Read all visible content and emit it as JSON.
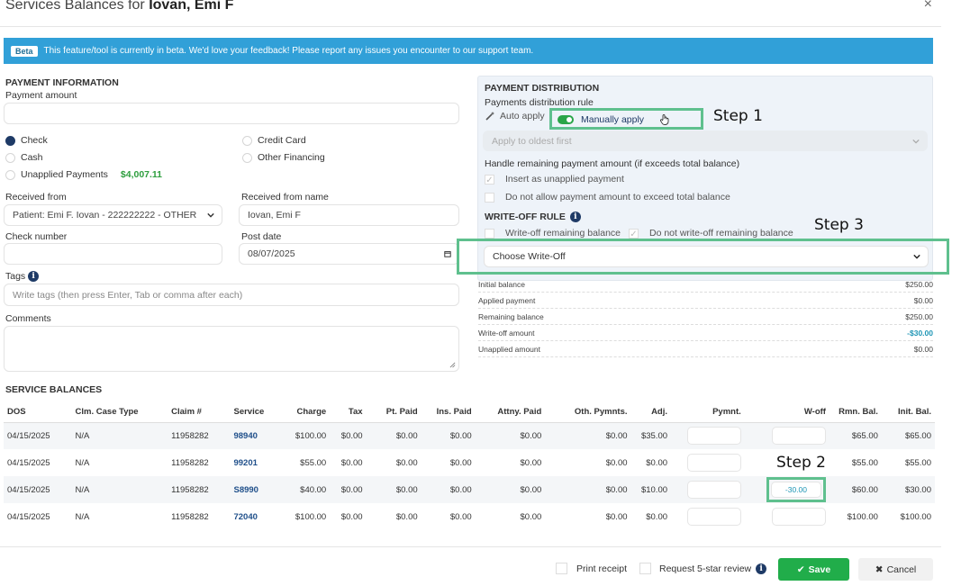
{
  "header": {
    "title_prefix": "Services Balances for",
    "title_name": "Iovan, Emi F",
    "close_label": "×"
  },
  "beta": {
    "pill": "Beta",
    "message": "This feature/tool is currently in beta. We'd love your feedback! Please report any issues you encounter to our support team."
  },
  "payment_info": {
    "title": "PAYMENT INFORMATION",
    "payment_amount_label": "Payment amount",
    "payment_amount_value": "",
    "methods": {
      "check": "Check",
      "credit_card": "Credit Card",
      "cash": "Cash",
      "other_financing": "Other Financing",
      "unapplied": "Unapplied Payments",
      "unapplied_amount": "$4,007.11",
      "selected": "check"
    },
    "received_from_label": "Received from",
    "received_from_value": "Patient: Emi F. Iovan - 222222222 - OTHER",
    "received_from_name_label": "Received from name",
    "received_from_name_value": "Iovan, Emi F",
    "check_number_label": "Check number",
    "check_number_value": "",
    "post_date_label": "Post date",
    "post_date_value": "08/07/2025",
    "tags_label": "Tags",
    "tags_placeholder": "Write tags (then press Enter, Tab or comma after each)",
    "comments_label": "Comments",
    "comments_value": ""
  },
  "distribution": {
    "title": "PAYMENT DISTRIBUTION",
    "rule_label": "Payments distribution rule",
    "auto_apply": "Auto apply",
    "manually_apply": "Manually apply",
    "apply_select": "Apply to oldest first",
    "remaining_label": "Handle remaining payment amount (if exceeds total balance)",
    "insert_unapplied": "Insert as unapplied payment",
    "do_not_allow": "Do not allow payment amount to exceed total balance",
    "writeoff_title": "WRITE-OFF RULE",
    "writeoff_remaining": "Write-off remaining balance",
    "do_not_writeoff": "Do not write-off remaining balance",
    "choose_writeoff": "Choose Write-Off"
  },
  "summary": [
    {
      "label": "Initial balance",
      "value": "$250.00"
    },
    {
      "label": "Applied payment",
      "value": "$0.00"
    },
    {
      "label": "Remaining balance",
      "value": "$250.00"
    },
    {
      "label": "Write-off amount",
      "value": "-$30.00"
    },
    {
      "label": "Unapplied amount",
      "value": "$0.00"
    }
  ],
  "steps": {
    "step1": "Step 1",
    "step2": "Step 2",
    "step3": "Step 3"
  },
  "service_balances": {
    "title": "SERVICE BALANCES",
    "columns": [
      "DOS",
      "Clm. Case Type",
      "Claim #",
      "Service",
      "Charge",
      "Tax",
      "Pt. Paid",
      "Ins. Paid",
      "Attny. Paid",
      "Oth. Pymnts.",
      "Adj.",
      "Pymnt.",
      "W-off",
      "Rmn. Bal.",
      "Init. Bal."
    ],
    "rows": [
      {
        "dos": "04/15/2025",
        "case": "N/A",
        "claim": "11958282",
        "service": "98940",
        "charge": "$100.00",
        "tax": "$0.00",
        "pt": "$0.00",
        "ins": "$0.00",
        "attny": "$0.00",
        "oth": "$0.00",
        "adj": "$35.00",
        "woff": "",
        "rmn": "$65.00",
        "init": "$65.00"
      },
      {
        "dos": "04/15/2025",
        "case": "N/A",
        "claim": "11958282",
        "service": "99201",
        "charge": "$55.00",
        "tax": "$0.00",
        "pt": "$0.00",
        "ins": "$0.00",
        "attny": "$0.00",
        "oth": "$0.00",
        "adj": "$0.00",
        "woff": "",
        "rmn": "$55.00",
        "init": "$55.00"
      },
      {
        "dos": "04/15/2025",
        "case": "N/A",
        "claim": "11958282",
        "service": "S8990",
        "charge": "$40.00",
        "tax": "$0.00",
        "pt": "$0.00",
        "ins": "$0.00",
        "attny": "$0.00",
        "oth": "$0.00",
        "adj": "$10.00",
        "woff": "-30.00",
        "rmn": "$60.00",
        "init": "$30.00"
      },
      {
        "dos": "04/15/2025",
        "case": "N/A",
        "claim": "11958282",
        "service": "72040",
        "charge": "$100.00",
        "tax": "$0.00",
        "pt": "$0.00",
        "ins": "$0.00",
        "attny": "$0.00",
        "oth": "$0.00",
        "adj": "$0.00",
        "woff": "",
        "rmn": "$100.00",
        "init": "$100.00"
      }
    ]
  },
  "footer": {
    "print_receipt": "Print receipt",
    "request_review": "Request 5-star review",
    "save": "Save",
    "cancel": "Cancel"
  },
  "colors": {
    "beta_bar": "#31a0d8",
    "save": "#21ad4a",
    "step_highlight": "#5fc08e",
    "link": "#1f4f8a"
  }
}
